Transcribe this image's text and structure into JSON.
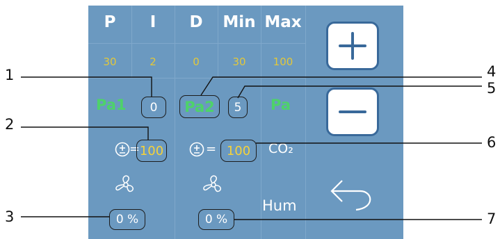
{
  "columns": {
    "headers": [
      "P",
      "I",
      "D",
      "Min",
      "Max"
    ],
    "values": [
      "30",
      "2",
      "0",
      "30",
      "100"
    ]
  },
  "row_pa": {
    "pa1_label": "Pa1",
    "pa1_value": "0",
    "pa2_label": "Pa2",
    "pa2_value": "5",
    "pa_label": "Pa"
  },
  "row_tol": {
    "tol1_value": "100",
    "tol2_value": "100",
    "co2_label": "CO₂",
    "equals": "="
  },
  "row_fan": {
    "fan1_value": "0 %",
    "fan2_value": "0 %",
    "hum_label": "Hum"
  },
  "callouts": [
    "1",
    "2",
    "3",
    "4",
    "5",
    "6",
    "7"
  ],
  "icons": {
    "plus": "plus-icon",
    "minus": "minus-icon",
    "back": "back-arrow-icon",
    "fan": "fan-icon",
    "tolerance": "plus-minus-icon"
  },
  "colors": {
    "panel": "#6b99c0",
    "header_text": "#ffffff",
    "value_text": "#e3c83a",
    "pa_text": "#4ed26a",
    "button_border": "#39699a"
  }
}
